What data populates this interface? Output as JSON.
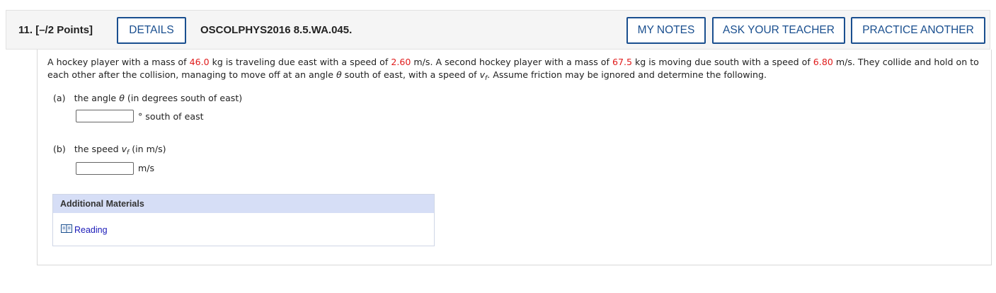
{
  "header": {
    "question_number": "11.",
    "points": "[–/2 Points]",
    "details_label": "DETAILS",
    "problem_code": "OSCOLPHYS2016 8.5.WA.045.",
    "my_notes_label": "MY NOTES",
    "ask_teacher_label": "ASK YOUR TEACHER",
    "practice_another_label": "PRACTICE ANOTHER"
  },
  "problem": {
    "t1": "A hockey player with a mass of ",
    "mass1": "46.0",
    "t2": " kg is traveling due east with a speed of ",
    "speed1": "2.60",
    "t3": " m/s. A second hockey player with a mass of ",
    "mass2": "67.5",
    "t4": " kg is moving due south with a speed of ",
    "speed2": "6.80",
    "t5": " m/s. They collide and hold on to each other after the collision, managing to move off at an angle ",
    "theta": "θ",
    "t6": " south of east, with a speed of ",
    "v": "v",
    "v_sub": "f",
    "t7": ". Assume friction may be ignored and determine the following."
  },
  "parts": [
    {
      "label": "(a)",
      "prompt_before": "the angle ",
      "symbol": "θ",
      "symbol_sub": "",
      "prompt_after": " (in degrees south of east)",
      "value": "",
      "unit": "° south of east"
    },
    {
      "label": "(b)",
      "prompt_before": "the speed ",
      "symbol": "v",
      "symbol_sub": "f",
      "prompt_after": " (in m/s)",
      "value": "",
      "unit": "m/s"
    }
  ],
  "materials": {
    "heading": "Additional Materials",
    "reading_label": "Reading"
  },
  "colors": {
    "accent": "#1a4f8f",
    "given_value": "#e01b1b",
    "materials_header": "#d6def6",
    "link": "#1a1ab8"
  }
}
